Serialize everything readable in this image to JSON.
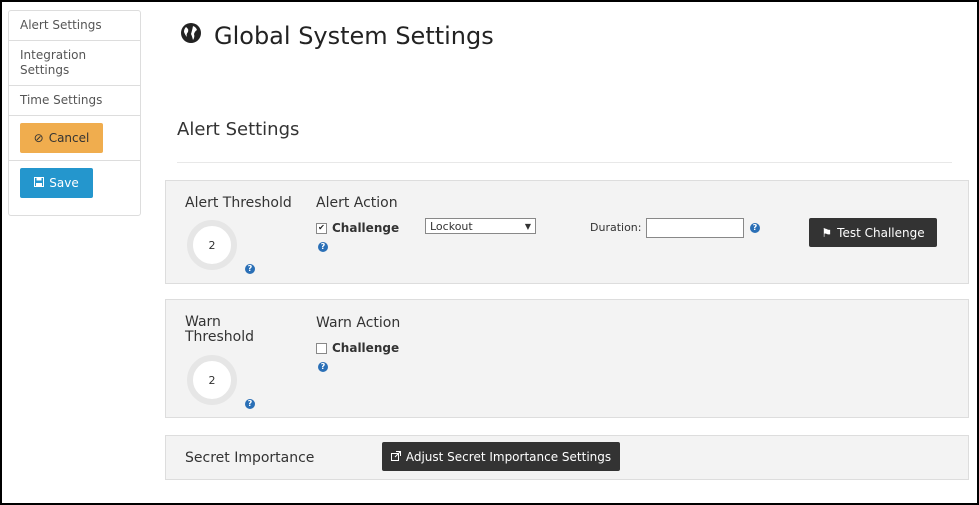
{
  "sidebar": {
    "items": [
      {
        "label": "Alert Settings"
      },
      {
        "label": "Integration Settings"
      },
      {
        "label": "Time Settings"
      }
    ],
    "cancel_label": "Cancel",
    "save_label": "Save"
  },
  "header": {
    "title": "Global System Settings",
    "section_title": "Alert Settings"
  },
  "alert": {
    "threshold_label": "Alert Threshold",
    "threshold_value": "2",
    "action_label": "Alert Action",
    "challenge_label": "Challenge",
    "challenge_checked": true,
    "select_value": "Lockout",
    "duration_label": "Duration:",
    "duration_value": "",
    "test_button_label": "Test Challenge"
  },
  "warn": {
    "threshold_label_line1": "Warn",
    "threshold_label_line2": "Threshold",
    "threshold_value": "2",
    "action_label": "Warn Action",
    "challenge_label": "Challenge",
    "challenge_checked": false
  },
  "secret": {
    "label": "Secret Importance",
    "button_label": "Adjust Secret Importance Settings"
  },
  "colors": {
    "cancel": "#f0ad4e",
    "save": "#2496cd",
    "dark_button": "#333333",
    "help_icon": "#2a6fb6"
  }
}
